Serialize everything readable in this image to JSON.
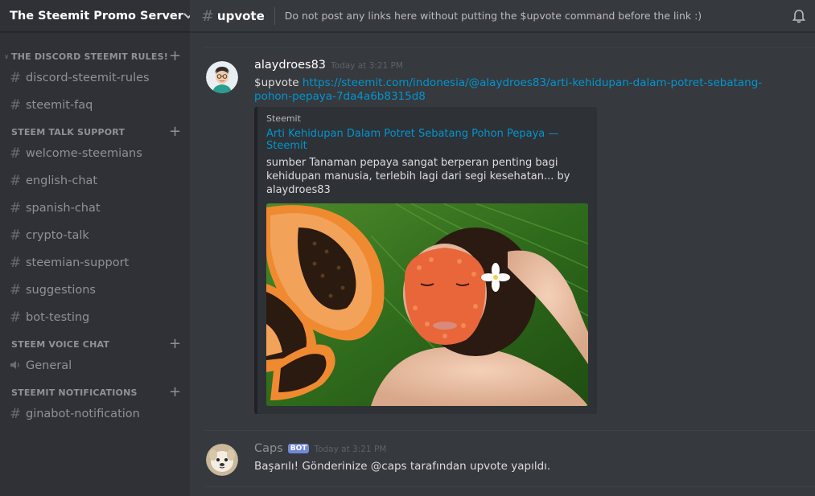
{
  "server": {
    "name": "The Steemit Promo Server"
  },
  "sidebar": {
    "categories": [
      {
        "label": "THE DISCORD STEEMIT RULES!",
        "channels": [
          "discord-steemit-rules",
          "steemit-faq"
        ]
      },
      {
        "label": "STEEM TALK SUPPORT",
        "channels": [
          "welcome-steemians",
          "english-chat",
          "spanish-chat",
          "crypto-talk",
          "steemian-support",
          "suggestions",
          "bot-testing"
        ]
      },
      {
        "label": "STEEM VOICE CHAT",
        "channels": [
          "General"
        ]
      },
      {
        "label": "STEEMIT NOTIFICATIONS",
        "channels": [
          "ginabot-notification"
        ]
      }
    ]
  },
  "topbar": {
    "channel": "upvote",
    "topic": "Do not post any links here without putting the $upvote command before the link :)"
  },
  "messages": [
    {
      "author": "alaydroes83",
      "timestamp": "Today at 3:21 PM",
      "command": "$upvote",
      "link": "https://steemit.com/indonesia/@alaydroes83/arti-kehidupan-dalam-potret-sebatang-pohon-pepaya-7da4a6b8315d8",
      "embed": {
        "provider": "Steemit",
        "title": "Arti Kehidupan Dalam Potret Sebatang Pohon Pepaya — Steemit",
        "description": "sumber        Tanaman pepaya sangat berperan penting bagi kehidupan manusia, terlebih lagi dari segi  kesehatan... by alaydroes83"
      }
    },
    {
      "author": "Caps",
      "bot_tag": "BOT",
      "timestamp": "Today at 3:21 PM",
      "text": "Başarılı! Gönderinize @caps tarafından upvote yapıldı."
    }
  ],
  "colors": {
    "sidebar_bg": "#2f3136",
    "main_bg": "#36393e",
    "link": "#0096cf",
    "bot_tag": "#7289da"
  }
}
